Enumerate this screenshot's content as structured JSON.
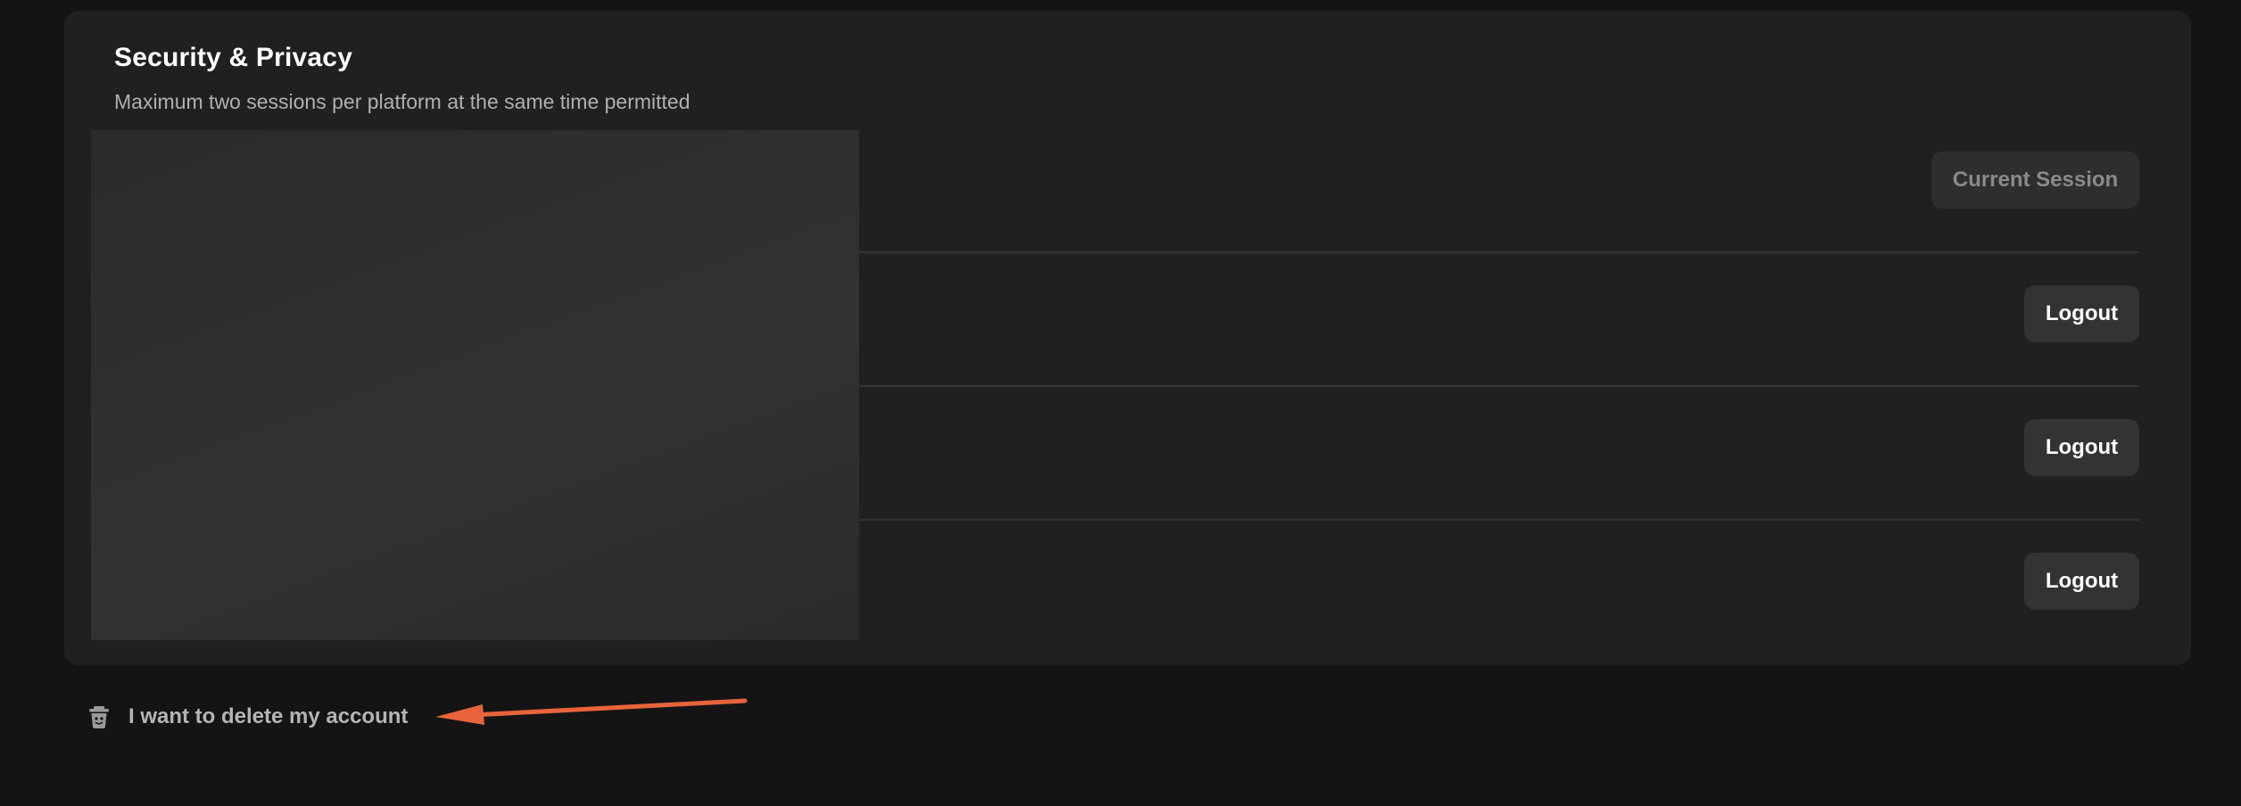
{
  "security": {
    "title": "Security & Privacy",
    "subtitle": "Maximum two sessions per platform at the same time permitted"
  },
  "sessions": [
    {
      "action_label": "Current Session",
      "is_current": true
    },
    {
      "action_label": "Logout",
      "is_current": false
    },
    {
      "action_label": "Logout",
      "is_current": false
    },
    {
      "action_label": "Logout",
      "is_current": false
    }
  ],
  "delete_account": {
    "label": "I want to delete my account",
    "icon": "trash-icon"
  },
  "colors": {
    "annotation_arrow": "#e8643a",
    "card_background": "#202020",
    "page_background": "#141414"
  }
}
